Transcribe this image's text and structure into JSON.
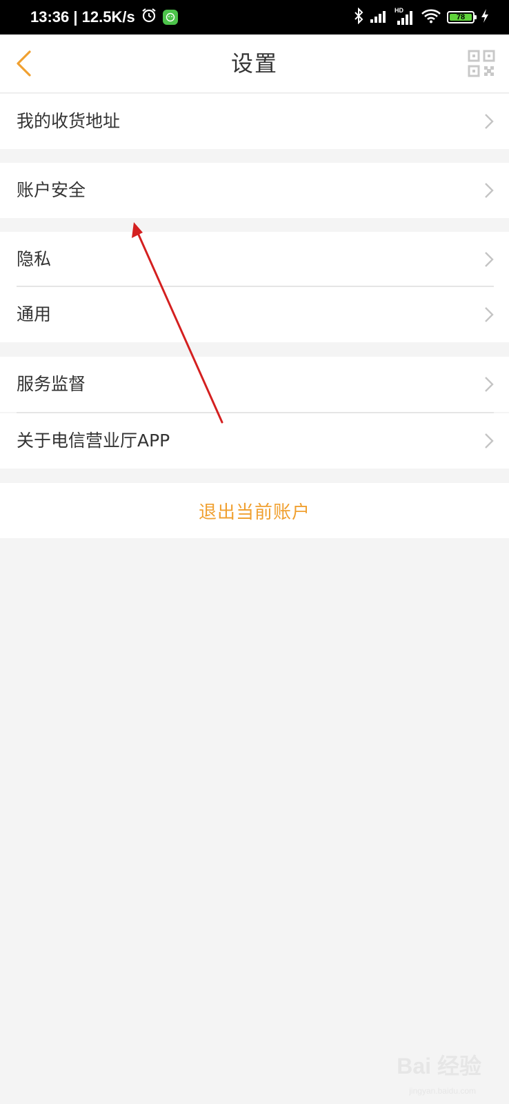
{
  "status_bar": {
    "time_speed": "13:36 | 12.5K/s",
    "network_label": "HD",
    "battery_level": "78",
    "icons": [
      "alarm-icon",
      "app-badge-icon",
      "bluetooth-icon",
      "signal-icon",
      "signal-hd-icon",
      "wifi-icon",
      "battery-icon",
      "charging-icon"
    ]
  },
  "header": {
    "title": "设置",
    "back_icon": "chevron-left-icon",
    "qr_icon": "qr-code-icon"
  },
  "menu": {
    "items": [
      {
        "label": "我的收货地址"
      },
      {
        "label": "账户安全"
      },
      {
        "label": "隐私"
      },
      {
        "label": "通用"
      },
      {
        "label": "服务监督"
      },
      {
        "label": "关于电信营业厅APP"
      }
    ]
  },
  "logout": {
    "label": "退出当前账户"
  },
  "colors": {
    "accent": "#f0a030",
    "background": "#f4f4f4",
    "annotation": "#d42020"
  },
  "watermark": {
    "brand": "Bai 经验",
    "url": "jingyan.baidu.com"
  }
}
